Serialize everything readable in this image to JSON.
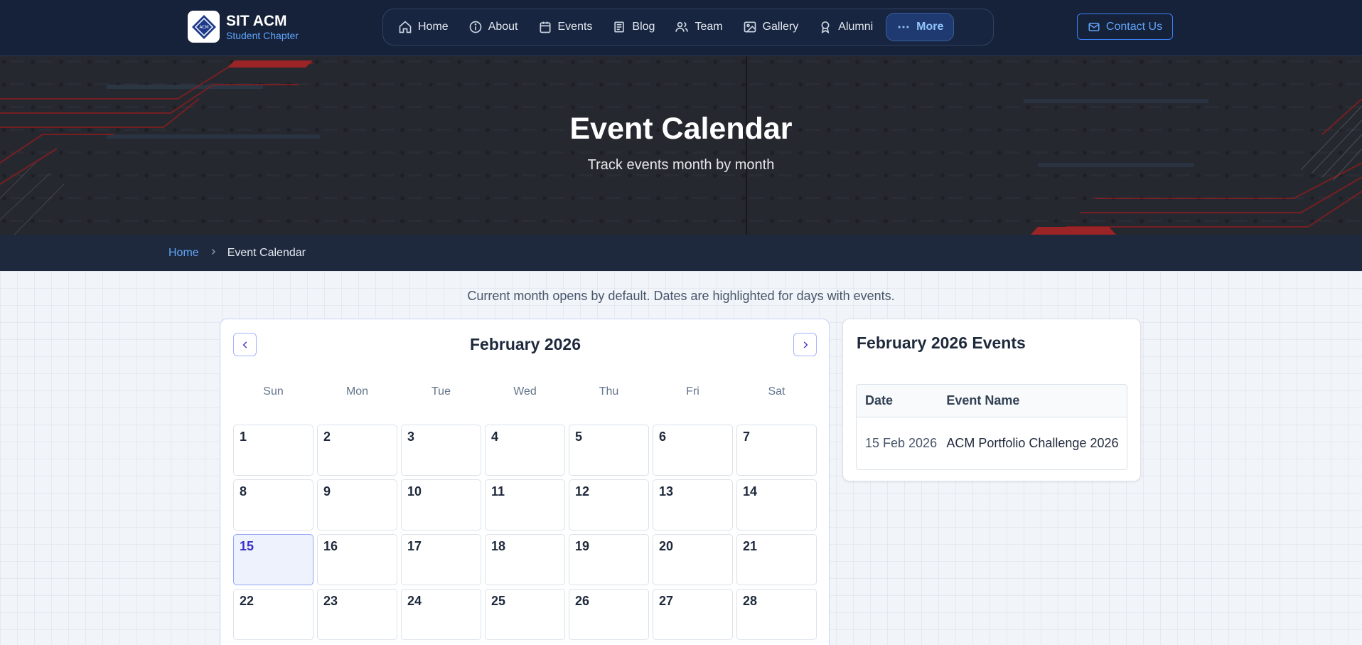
{
  "brand": {
    "title": "SIT ACM",
    "subtitle": "Student Chapter",
    "logo_text": "ACM"
  },
  "nav": {
    "items": [
      {
        "label": "Home",
        "icon": "home-icon"
      },
      {
        "label": "About",
        "icon": "info-icon"
      },
      {
        "label": "Events",
        "icon": "calendar-icon"
      },
      {
        "label": "Blog",
        "icon": "newspaper-icon"
      },
      {
        "label": "Team",
        "icon": "users-icon"
      },
      {
        "label": "Gallery",
        "icon": "image-icon"
      },
      {
        "label": "Alumni",
        "icon": "award-icon"
      },
      {
        "label": "More",
        "icon": "more-dots-icon"
      }
    ],
    "contact_label": "Contact Us"
  },
  "hero": {
    "title": "Event Calendar",
    "subtitle": "Track events month by month"
  },
  "breadcrumb": {
    "home": "Home",
    "current": "Event Calendar"
  },
  "note": "Current month opens by default. Dates are highlighted for days with events.",
  "calendar": {
    "month_label": "February 2026",
    "weekdays": [
      "Sun",
      "Mon",
      "Tue",
      "Wed",
      "Thu",
      "Fri",
      "Sat"
    ],
    "days": [
      "1",
      "2",
      "3",
      "4",
      "5",
      "6",
      "7",
      "8",
      "9",
      "10",
      "11",
      "12",
      "13",
      "14",
      "15",
      "16",
      "17",
      "18",
      "19",
      "20",
      "21",
      "22",
      "23",
      "24",
      "25",
      "26",
      "27",
      "28"
    ],
    "highlighted_day": "15"
  },
  "events": {
    "title": "February 2026 Events",
    "headers": {
      "date": "Date",
      "name": "Event Name"
    },
    "rows": [
      {
        "date": "15 Feb 2026",
        "name": "ACM Portfolio Challenge 2026"
      }
    ]
  },
  "colors": {
    "accent": "#3b82f6",
    "navbar": "#16213a",
    "highlight": "#eef2fc"
  }
}
